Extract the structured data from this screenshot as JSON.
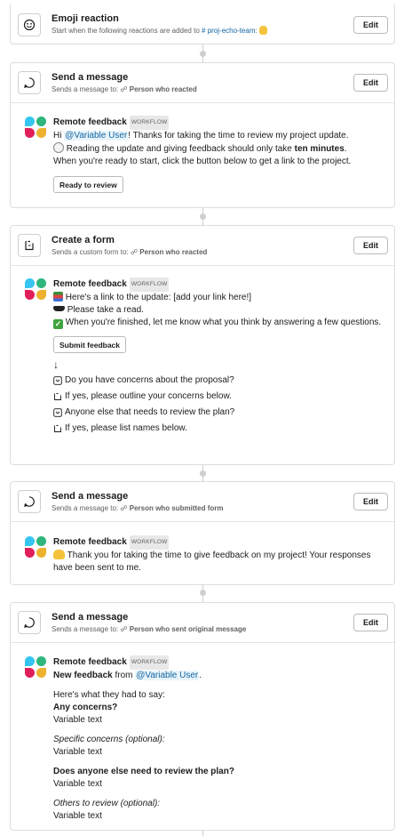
{
  "steps": [
    {
      "title": "Emoji reaction",
      "subtitle_prefix": "Start when the following reactions are added to",
      "channel": "# proj-echo-team",
      "edit_label": "Edit"
    },
    {
      "title": "Send a message",
      "subtitle_prefix": "Sends a message to:",
      "recipient": "Person who reacted",
      "edit_label": "Edit",
      "message": {
        "sender": "Remote feedback",
        "tag": "WORKFLOW",
        "hi": "Hi",
        "mention": "@Variable User",
        "line1_rest": "! Thanks for taking the time to review my project update.",
        "line2_pre": "Reading the update and giving feedback should only take",
        "line2_bold": "ten minutes",
        "line2_post": ".",
        "line3": "When you're ready to start, click the button below to get a link to the project.",
        "button": "Ready to review"
      }
    },
    {
      "title": "Create a form",
      "subtitle_prefix": "Sends a custom form to:",
      "recipient": "Person who reacted",
      "edit_label": "Edit",
      "message": {
        "sender": "Remote feedback",
        "tag": "WORKFLOW",
        "line1": "Here's a link to the update: [add your link here!]",
        "line2": "Please take a read.",
        "line3": "When you're finished, let me know what you think by answering a few questions.",
        "button": "Submit feedback",
        "arrow": "↓",
        "questions": [
          "Do you have concerns about the proposal?",
          "If yes, please outline your concerns below.",
          "Anyone else that needs to review the plan?",
          "If yes, please list names below."
        ]
      }
    },
    {
      "title": "Send a message",
      "subtitle_prefix": "Sends a message to:",
      "recipient": "Person who submitted form",
      "edit_label": "Edit",
      "message": {
        "sender": "Remote feedback",
        "tag": "WORKFLOW",
        "line1": "Thank you for taking the time to give feedback on my project! Your responses have been sent to me."
      }
    },
    {
      "title": "Send a message",
      "subtitle_prefix": "Sends a message to:",
      "recipient": "Person who sent original message",
      "edit_label": "Edit",
      "message": {
        "sender": "Remote feedback",
        "tag": "WORKFLOW",
        "line1_bold": "New feedback",
        "line1_from": "from",
        "mention": "@Variable User",
        "line1_end": ".",
        "intro": "Here's what they had to say:",
        "q1": "Any concerns?",
        "a1": "Variable text",
        "q2": "Specific concerns (optional):",
        "a2": "Variable text",
        "q3": "Does anyone else need to review the plan?",
        "a3": "Variable text",
        "q4": "Others to review (optional):",
        "a4": "Variable text"
      }
    }
  ],
  "colors": {
    "link": "#1264a3",
    "border": "#dddddd",
    "avatar": [
      "#36c5f0",
      "#2eb67d",
      "#e01e5a",
      "#ecb22e"
    ]
  },
  "icons": {
    "step1": "emoji-icon",
    "step2": "message-bubble-icon",
    "step3": "form-icon",
    "step4": "message-bubble-icon",
    "step5": "message-bubble-icon"
  }
}
